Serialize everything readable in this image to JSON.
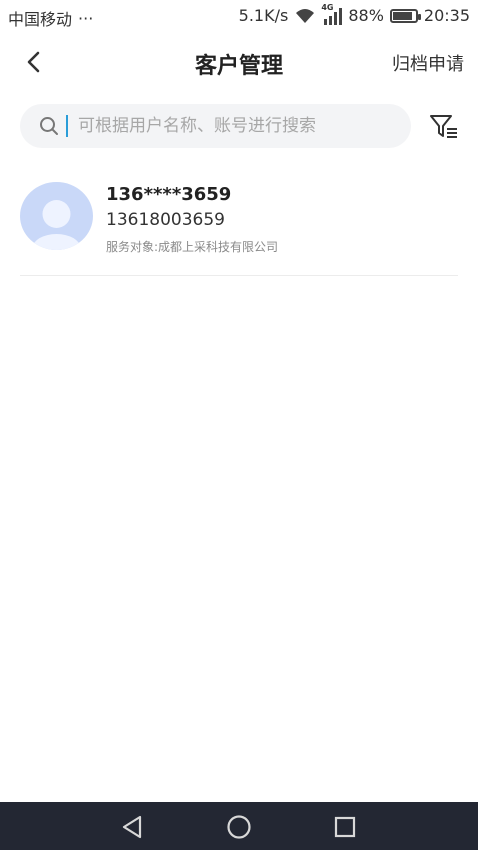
{
  "status_bar": {
    "carrier": "中国移动",
    "more": "···",
    "speed": "5.1K/s",
    "network": "4G",
    "battery": "88%",
    "battery_level": 0.88,
    "time": "20:35"
  },
  "header": {
    "title": "客户管理",
    "archive_label": "归档申请"
  },
  "search": {
    "placeholder": "可根据用户名称、账号进行搜索"
  },
  "clients": [
    {
      "name": "136****3659",
      "phone": "13618003659",
      "service": "服务对象:成都上采科技有限公司"
    }
  ],
  "colors": {
    "avatar_bg": "#c9d8f8",
    "nav_bg": "#232733",
    "search_bg": "#f3f4f6",
    "caret": "#2a9dd8"
  },
  "icons": {
    "back": "chevron-left-icon",
    "search": "search-icon",
    "filter": "filter-icon",
    "wifi": "wifi-icon",
    "signal": "signal-icon",
    "battery": "battery-icon",
    "nav_back": "triangle-back-icon",
    "nav_home": "circle-home-icon",
    "nav_recent": "square-recent-icon"
  }
}
